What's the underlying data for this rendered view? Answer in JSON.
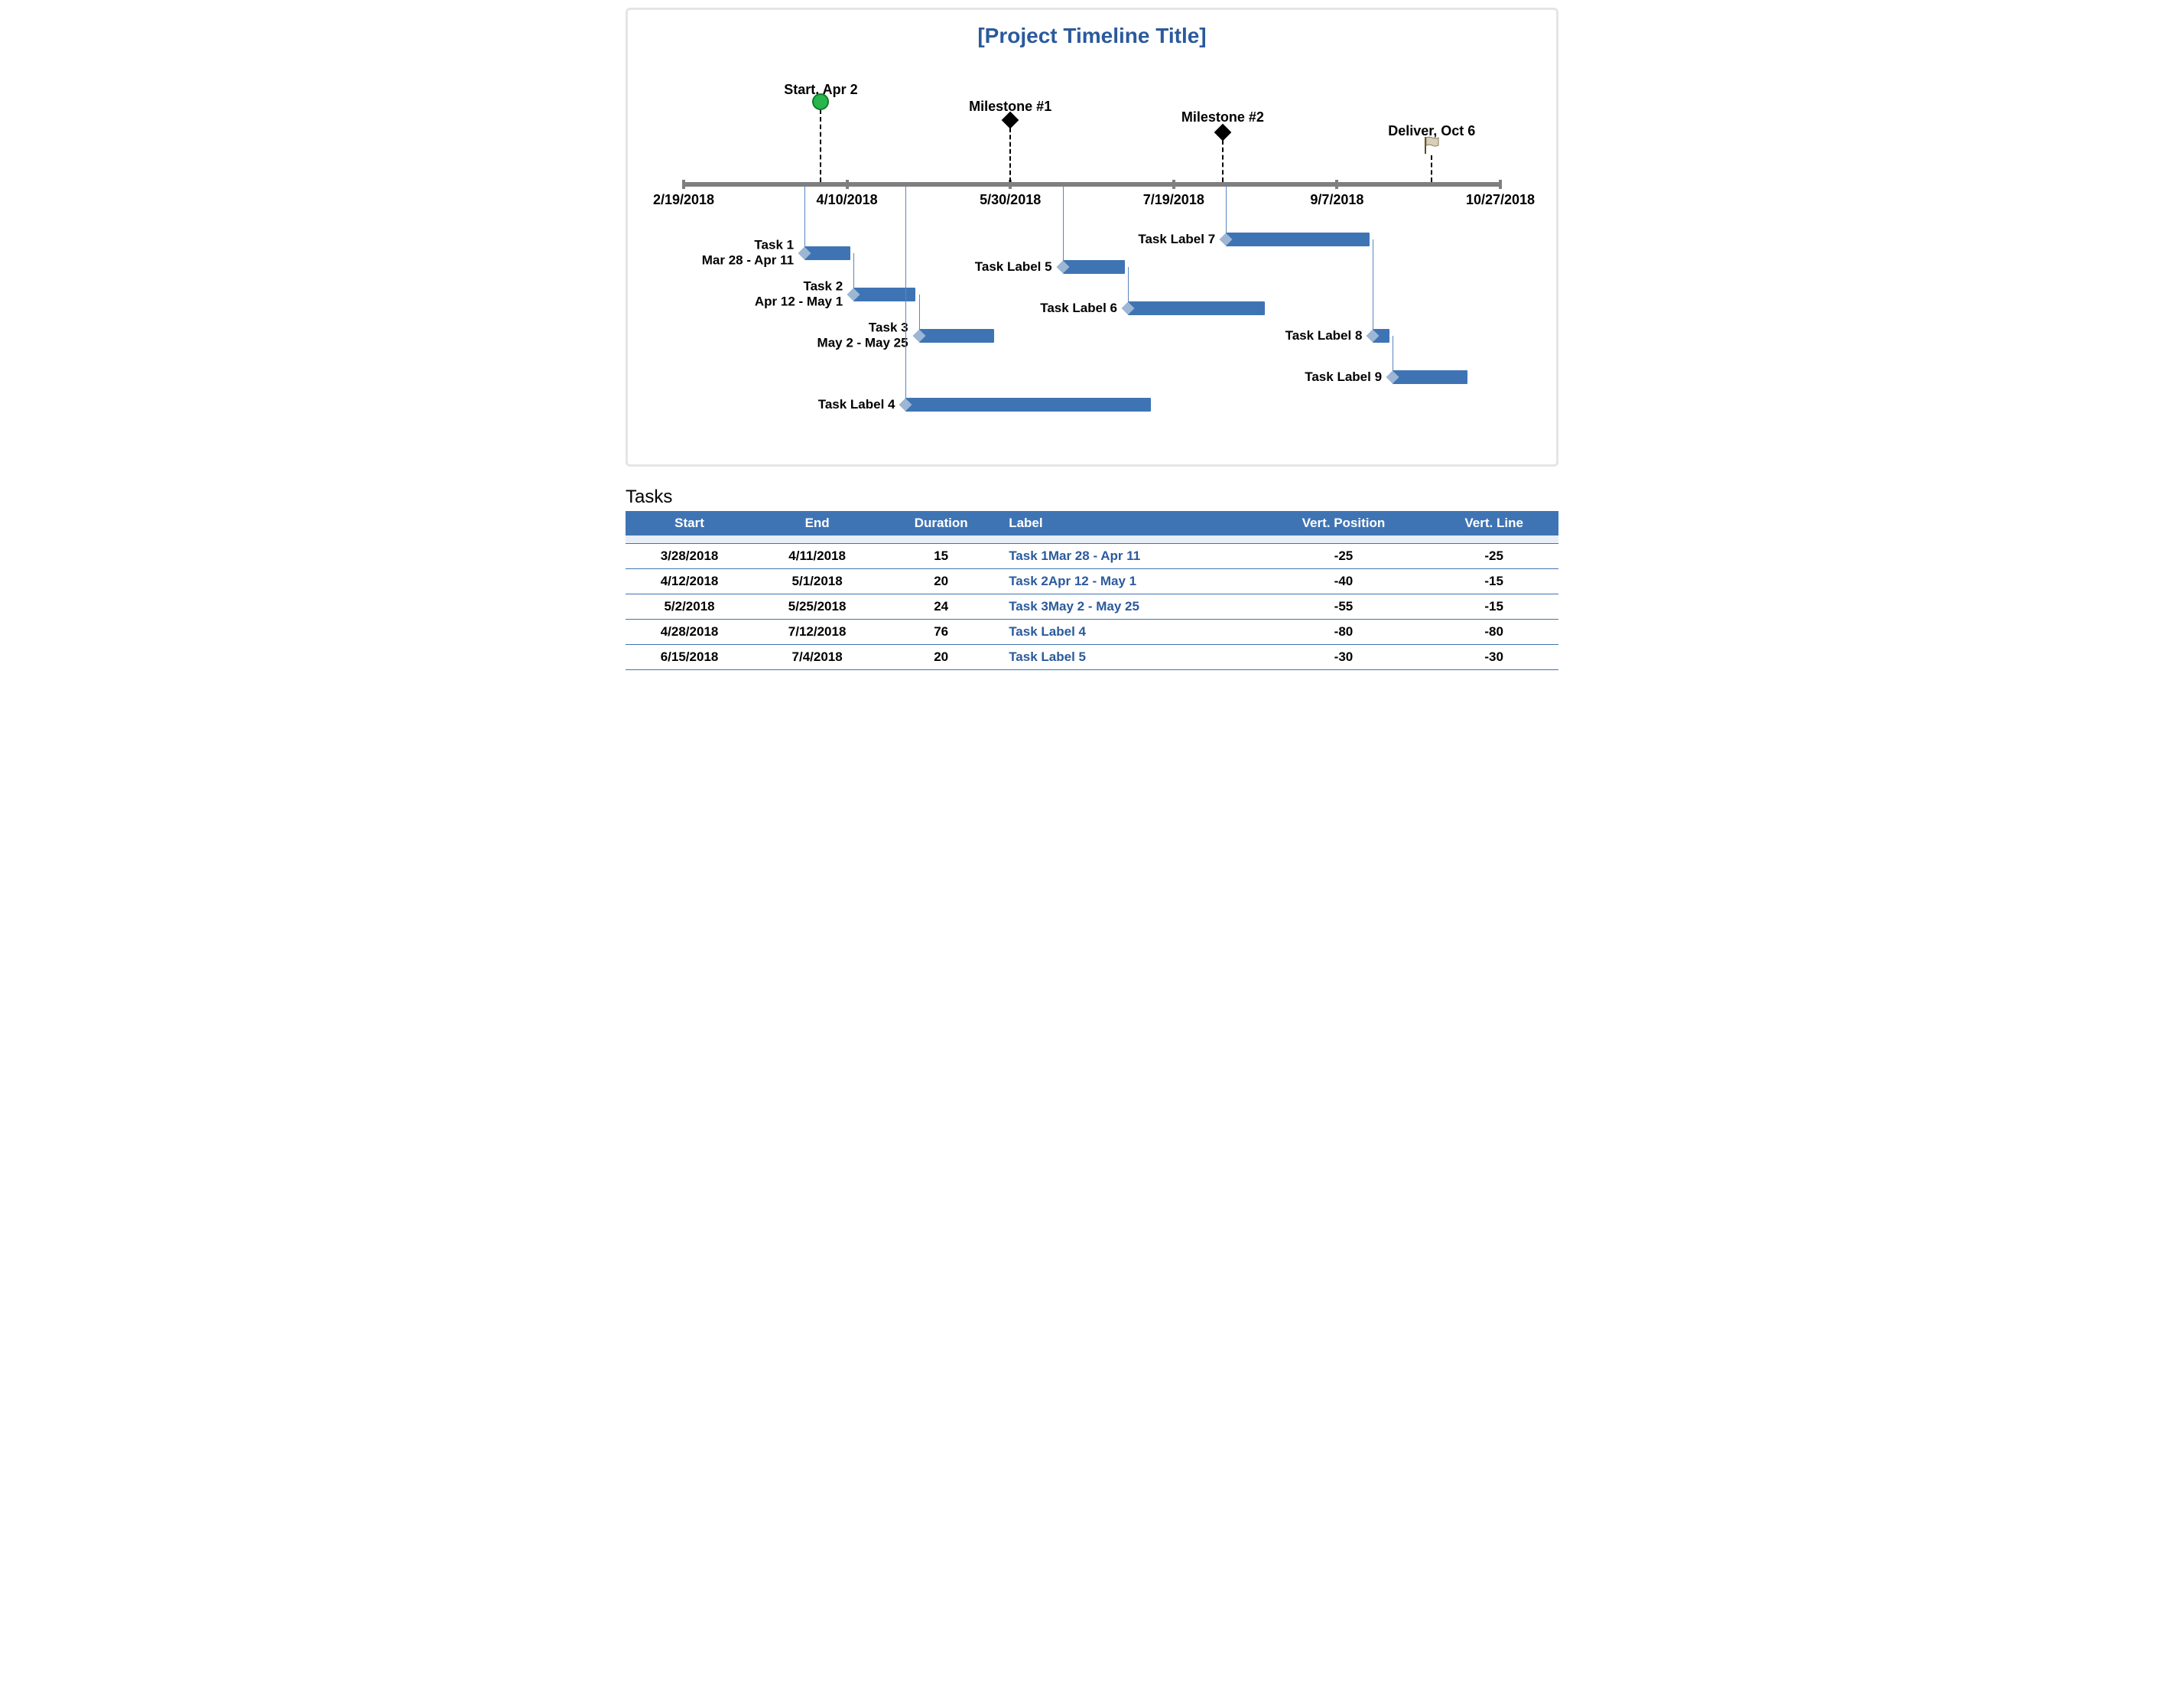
{
  "title": "[Project Timeline Title]",
  "axis": {
    "ticks": [
      {
        "date": "2/19/2018"
      },
      {
        "date": "4/10/2018"
      },
      {
        "date": "5/30/2018"
      },
      {
        "date": "7/19/2018"
      },
      {
        "date": "9/7/2018"
      },
      {
        "date": "10/27/2018"
      }
    ],
    "start_serial": 43150,
    "end_serial": 43400
  },
  "milestones": [
    {
      "label": "Start, Apr 2",
      "date": "4/2/2018",
      "serial": 43192,
      "marker": "circle",
      "label_y": 36,
      "marker_y": 62
    },
    {
      "label": "Milestone #1",
      "date": "5/30/2018",
      "serial": 43250,
      "marker": "diamond",
      "label_y": 58,
      "marker_y": 86
    },
    {
      "label": "Milestone #2",
      "date": "8/3/2018",
      "serial": 43315,
      "marker": "diamond",
      "label_y": 72,
      "marker_y": 102
    },
    {
      "label": "Deliver, Oct 6",
      "date": "10/6/2018",
      "serial": 43379,
      "marker": "flag",
      "label_y": 90,
      "marker_y": 122
    }
  ],
  "tasks_chart": [
    {
      "label": "Task 1\nMar 28 - Apr 11",
      "start": 43187,
      "end": 43201,
      "vp": -25,
      "vl": -25
    },
    {
      "label": "Task 2\nApr 12 - May 1",
      "start": 43202,
      "end": 43221,
      "vp": -40,
      "vl": -15
    },
    {
      "label": "Task 3\nMay 2 - May 25",
      "start": 43222,
      "end": 43245,
      "vp": -55,
      "vl": -15
    },
    {
      "label": "Task Label 4",
      "start": 43218,
      "end": 43293,
      "vp": -80,
      "vl": -80
    },
    {
      "label": "Task Label 5",
      "start": 43266,
      "end": 43285,
      "vp": -30,
      "vl": -30
    },
    {
      "label": "Task Label 6",
      "start": 43286,
      "end": 43328,
      "vp": -45,
      "vl": -15
    },
    {
      "label": "Task Label 7",
      "start": 43316,
      "end": 43360,
      "vp": -20,
      "vl": -20
    },
    {
      "label": "Task Label 8",
      "start": 43361,
      "end": 43366,
      "vp": -55,
      "vl": -35
    },
    {
      "label": "Task Label 9",
      "start": 43367,
      "end": 43390,
      "vp": -70,
      "vl": -15
    }
  ],
  "tasks_heading": "Tasks",
  "columns": [
    "Start",
    "End",
    "Duration",
    "Label",
    "Vert. Position",
    "Vert. Line"
  ],
  "rows": [
    {
      "start": "3/28/2018",
      "end": "4/11/2018",
      "duration": 15,
      "label": "Task 1Mar 28 - Apr 11",
      "vp": -25,
      "vl": -25
    },
    {
      "start": "4/12/2018",
      "end": "5/1/2018",
      "duration": 20,
      "label": "Task 2Apr 12 - May 1",
      "vp": -40,
      "vl": -15
    },
    {
      "start": "5/2/2018",
      "end": "5/25/2018",
      "duration": 24,
      "label": "Task 3May 2 - May 25",
      "vp": -55,
      "vl": -15
    },
    {
      "start": "4/28/2018",
      "end": "7/12/2018",
      "duration": 76,
      "label": "Task Label 4",
      "vp": -80,
      "vl": -80
    },
    {
      "start": "6/15/2018",
      "end": "7/4/2018",
      "duration": 20,
      "label": "Task Label 5",
      "vp": -30,
      "vl": -30
    }
  ],
  "chart_data": {
    "type": "bar",
    "title": "[Project Timeline Title]",
    "xlabel": "",
    "ylabel": "",
    "x_tick_labels": [
      "2/19/2018",
      "4/10/2018",
      "5/30/2018",
      "7/19/2018",
      "9/7/2018",
      "10/27/2018"
    ],
    "xlim": [
      "2/19/2018",
      "10/27/2018"
    ],
    "series": [
      {
        "name": "Task 1 Mar 28 - Apr 11",
        "start": "3/28/2018",
        "end": "4/11/2018",
        "duration": 15,
        "vert_position": -25,
        "vert_line": -25
      },
      {
        "name": "Task 2 Apr 12 - May 1",
        "start": "4/12/2018",
        "end": "5/1/2018",
        "duration": 20,
        "vert_position": -40,
        "vert_line": -15
      },
      {
        "name": "Task 3 May 2 - May 25",
        "start": "5/2/2018",
        "end": "5/25/2018",
        "duration": 24,
        "vert_position": -55,
        "vert_line": -15
      },
      {
        "name": "Task Label 4",
        "start": "4/28/2018",
        "end": "7/12/2018",
        "duration": 76,
        "vert_position": -80,
        "vert_line": -80
      },
      {
        "name": "Task Label 5",
        "start": "6/15/2018",
        "end": "7/4/2018",
        "duration": 20,
        "vert_position": -30,
        "vert_line": -30
      },
      {
        "name": "Task Label 6",
        "start": "7/5/2018",
        "end": "8/16/2018",
        "vert_position": -45,
        "vert_line": -15
      },
      {
        "name": "Task Label 7",
        "start": "8/4/2018",
        "end": "9/17/2018",
        "vert_position": -20,
        "vert_line": -20
      },
      {
        "name": "Task Label 8",
        "start": "9/18/2018",
        "end": "9/23/2018",
        "vert_position": -55,
        "vert_line": -35
      },
      {
        "name": "Task Label 9",
        "start": "9/24/2018",
        "end": "10/17/2018",
        "vert_position": -70,
        "vert_line": -15
      }
    ],
    "milestones": [
      {
        "name": "Start, Apr 2",
        "date": "4/2/2018",
        "marker": "circle"
      },
      {
        "name": "Milestone #1",
        "date": "5/30/2018",
        "marker": "diamond"
      },
      {
        "name": "Milestone #2",
        "date": "8/3/2018",
        "marker": "diamond"
      },
      {
        "name": "Deliver, Oct 6",
        "date": "10/6/2018",
        "marker": "flag"
      }
    ]
  }
}
